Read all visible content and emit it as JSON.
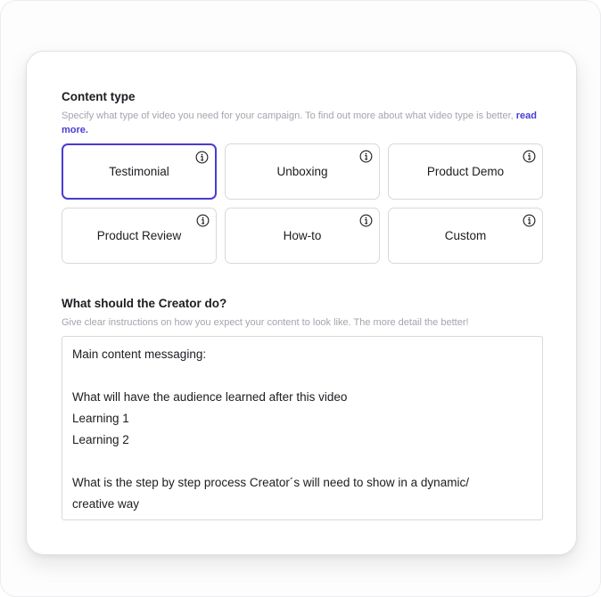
{
  "content_type": {
    "title": "Content type",
    "help_text": "Specify what type of video you need for your campaign. To find out more about what video type is better,",
    "help_link": "read more.",
    "options": [
      {
        "label": "Testimonial",
        "selected": true
      },
      {
        "label": "Unboxing",
        "selected": false
      },
      {
        "label": "Product Demo",
        "selected": false
      },
      {
        "label": "Product Review",
        "selected": false
      },
      {
        "label": "How-to",
        "selected": false
      },
      {
        "label": "Custom",
        "selected": false
      }
    ]
  },
  "instructions": {
    "title": "What should the Creator do?",
    "help_text": "Give clear instructions on how you expect your content to look like. The more detail the better!",
    "lines": [
      "Main content messaging:",
      "",
      "What will have the audience learned after this video",
      "Learning 1",
      "Learning 2",
      "",
      "What is the step by step process Creator´s will need to show in a dynamic/",
      "creative way"
    ]
  },
  "colors": {
    "accent": "#4a3bd3",
    "border": "#d8d8de",
    "muted_text": "#a4a4ad"
  },
  "icons": {
    "tile_info": "info-icon"
  }
}
